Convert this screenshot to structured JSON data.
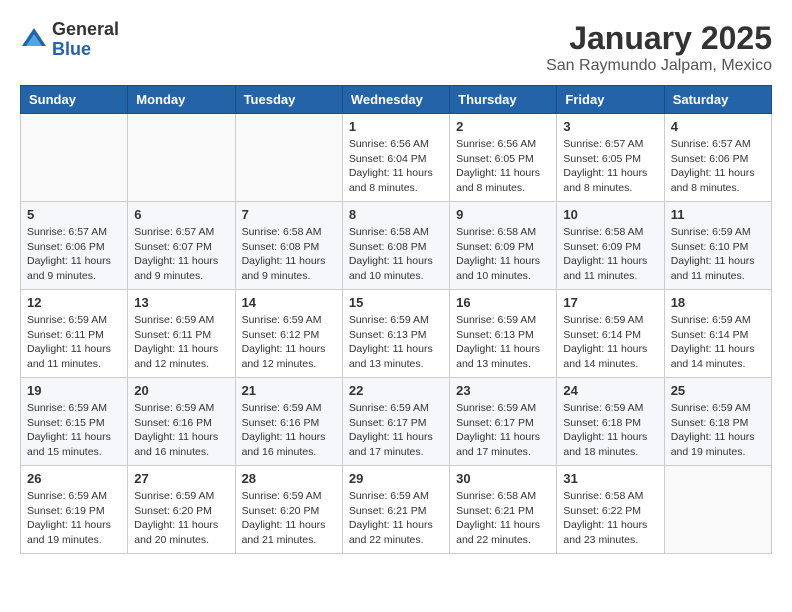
{
  "header": {
    "logo": {
      "general": "General",
      "blue": "Blue"
    },
    "title": "January 2025",
    "subtitle": "San Raymundo Jalpam, Mexico"
  },
  "days_of_week": [
    "Sunday",
    "Monday",
    "Tuesday",
    "Wednesday",
    "Thursday",
    "Friday",
    "Saturday"
  ],
  "weeks": [
    [
      {
        "day": "",
        "sunrise": "",
        "sunset": "",
        "daylight": ""
      },
      {
        "day": "",
        "sunrise": "",
        "sunset": "",
        "daylight": ""
      },
      {
        "day": "",
        "sunrise": "",
        "sunset": "",
        "daylight": ""
      },
      {
        "day": "1",
        "sunrise": "Sunrise: 6:56 AM",
        "sunset": "Sunset: 6:04 PM",
        "daylight": "Daylight: 11 hours and 8 minutes."
      },
      {
        "day": "2",
        "sunrise": "Sunrise: 6:56 AM",
        "sunset": "Sunset: 6:05 PM",
        "daylight": "Daylight: 11 hours and 8 minutes."
      },
      {
        "day": "3",
        "sunrise": "Sunrise: 6:57 AM",
        "sunset": "Sunset: 6:05 PM",
        "daylight": "Daylight: 11 hours and 8 minutes."
      },
      {
        "day": "4",
        "sunrise": "Sunrise: 6:57 AM",
        "sunset": "Sunset: 6:06 PM",
        "daylight": "Daylight: 11 hours and 8 minutes."
      }
    ],
    [
      {
        "day": "5",
        "sunrise": "Sunrise: 6:57 AM",
        "sunset": "Sunset: 6:06 PM",
        "daylight": "Daylight: 11 hours and 9 minutes."
      },
      {
        "day": "6",
        "sunrise": "Sunrise: 6:57 AM",
        "sunset": "Sunset: 6:07 PM",
        "daylight": "Daylight: 11 hours and 9 minutes."
      },
      {
        "day": "7",
        "sunrise": "Sunrise: 6:58 AM",
        "sunset": "Sunset: 6:08 PM",
        "daylight": "Daylight: 11 hours and 9 minutes."
      },
      {
        "day": "8",
        "sunrise": "Sunrise: 6:58 AM",
        "sunset": "Sunset: 6:08 PM",
        "daylight": "Daylight: 11 hours and 10 minutes."
      },
      {
        "day": "9",
        "sunrise": "Sunrise: 6:58 AM",
        "sunset": "Sunset: 6:09 PM",
        "daylight": "Daylight: 11 hours and 10 minutes."
      },
      {
        "day": "10",
        "sunrise": "Sunrise: 6:58 AM",
        "sunset": "Sunset: 6:09 PM",
        "daylight": "Daylight: 11 hours and 11 minutes."
      },
      {
        "day": "11",
        "sunrise": "Sunrise: 6:59 AM",
        "sunset": "Sunset: 6:10 PM",
        "daylight": "Daylight: 11 hours and 11 minutes."
      }
    ],
    [
      {
        "day": "12",
        "sunrise": "Sunrise: 6:59 AM",
        "sunset": "Sunset: 6:11 PM",
        "daylight": "Daylight: 11 hours and 11 minutes."
      },
      {
        "day": "13",
        "sunrise": "Sunrise: 6:59 AM",
        "sunset": "Sunset: 6:11 PM",
        "daylight": "Daylight: 11 hours and 12 minutes."
      },
      {
        "day": "14",
        "sunrise": "Sunrise: 6:59 AM",
        "sunset": "Sunset: 6:12 PM",
        "daylight": "Daylight: 11 hours and 12 minutes."
      },
      {
        "day": "15",
        "sunrise": "Sunrise: 6:59 AM",
        "sunset": "Sunset: 6:13 PM",
        "daylight": "Daylight: 11 hours and 13 minutes."
      },
      {
        "day": "16",
        "sunrise": "Sunrise: 6:59 AM",
        "sunset": "Sunset: 6:13 PM",
        "daylight": "Daylight: 11 hours and 13 minutes."
      },
      {
        "day": "17",
        "sunrise": "Sunrise: 6:59 AM",
        "sunset": "Sunset: 6:14 PM",
        "daylight": "Daylight: 11 hours and 14 minutes."
      },
      {
        "day": "18",
        "sunrise": "Sunrise: 6:59 AM",
        "sunset": "Sunset: 6:14 PM",
        "daylight": "Daylight: 11 hours and 14 minutes."
      }
    ],
    [
      {
        "day": "19",
        "sunrise": "Sunrise: 6:59 AM",
        "sunset": "Sunset: 6:15 PM",
        "daylight": "Daylight: 11 hours and 15 minutes."
      },
      {
        "day": "20",
        "sunrise": "Sunrise: 6:59 AM",
        "sunset": "Sunset: 6:16 PM",
        "daylight": "Daylight: 11 hours and 16 minutes."
      },
      {
        "day": "21",
        "sunrise": "Sunrise: 6:59 AM",
        "sunset": "Sunset: 6:16 PM",
        "daylight": "Daylight: 11 hours and 16 minutes."
      },
      {
        "day": "22",
        "sunrise": "Sunrise: 6:59 AM",
        "sunset": "Sunset: 6:17 PM",
        "daylight": "Daylight: 11 hours and 17 minutes."
      },
      {
        "day": "23",
        "sunrise": "Sunrise: 6:59 AM",
        "sunset": "Sunset: 6:17 PM",
        "daylight": "Daylight: 11 hours and 17 minutes."
      },
      {
        "day": "24",
        "sunrise": "Sunrise: 6:59 AM",
        "sunset": "Sunset: 6:18 PM",
        "daylight": "Daylight: 11 hours and 18 minutes."
      },
      {
        "day": "25",
        "sunrise": "Sunrise: 6:59 AM",
        "sunset": "Sunset: 6:18 PM",
        "daylight": "Daylight: 11 hours and 19 minutes."
      }
    ],
    [
      {
        "day": "26",
        "sunrise": "Sunrise: 6:59 AM",
        "sunset": "Sunset: 6:19 PM",
        "daylight": "Daylight: 11 hours and 19 minutes."
      },
      {
        "day": "27",
        "sunrise": "Sunrise: 6:59 AM",
        "sunset": "Sunset: 6:20 PM",
        "daylight": "Daylight: 11 hours and 20 minutes."
      },
      {
        "day": "28",
        "sunrise": "Sunrise: 6:59 AM",
        "sunset": "Sunset: 6:20 PM",
        "daylight": "Daylight: 11 hours and 21 minutes."
      },
      {
        "day": "29",
        "sunrise": "Sunrise: 6:59 AM",
        "sunset": "Sunset: 6:21 PM",
        "daylight": "Daylight: 11 hours and 22 minutes."
      },
      {
        "day": "30",
        "sunrise": "Sunrise: 6:58 AM",
        "sunset": "Sunset: 6:21 PM",
        "daylight": "Daylight: 11 hours and 22 minutes."
      },
      {
        "day": "31",
        "sunrise": "Sunrise: 6:58 AM",
        "sunset": "Sunset: 6:22 PM",
        "daylight": "Daylight: 11 hours and 23 minutes."
      },
      {
        "day": "",
        "sunrise": "",
        "sunset": "",
        "daylight": ""
      }
    ]
  ]
}
